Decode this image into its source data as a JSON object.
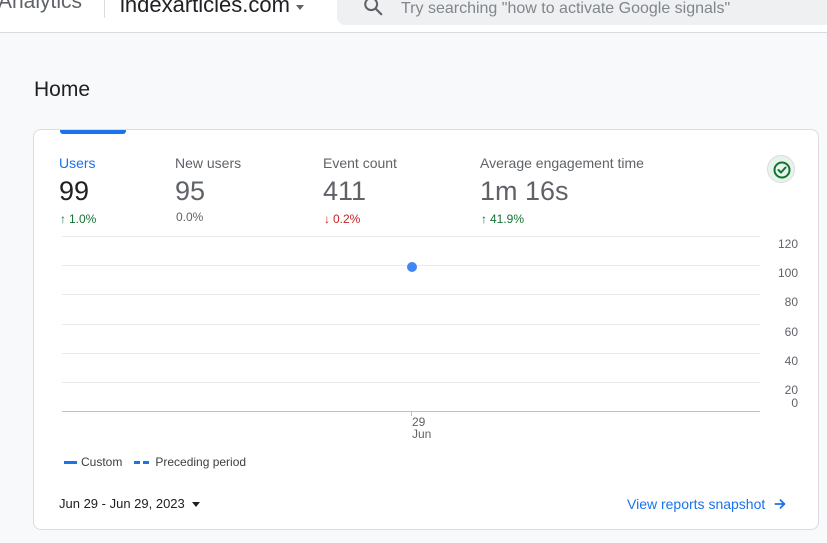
{
  "header": {
    "product_name": "Analytics",
    "property_name": "indexarticles.com",
    "search_placeholder": "Try searching \"how to activate Google signals\""
  },
  "page": {
    "title": "Home"
  },
  "metrics": [
    {
      "label": "Users",
      "value": "99",
      "change": "1.0%",
      "direction": "up",
      "active": true
    },
    {
      "label": "New users",
      "value": "95",
      "change": "0.0%",
      "direction": "none",
      "active": false
    },
    {
      "label": "Event count",
      "value": "411",
      "change": "0.2%",
      "direction": "down",
      "active": false
    },
    {
      "label": "Average engagement time",
      "value": "1m 16s",
      "change": "41.9%",
      "direction": "up",
      "active": false
    }
  ],
  "status_icon": "check-circle-icon",
  "chart_data": {
    "type": "line",
    "x": [
      "29 Jun"
    ],
    "x_tick_labels": [
      [
        "29",
        "Jun"
      ]
    ],
    "series": [
      {
        "name": "Custom",
        "values": [
          99
        ]
      }
    ],
    "y_ticks": [
      120,
      100,
      80,
      60,
      40,
      20,
      0
    ],
    "ylim": [
      0,
      120
    ],
    "grid": true,
    "legend": [
      "Custom",
      "Preceding period"
    ],
    "legend_position": "bottom-left"
  },
  "footer": {
    "date_range": "Jun 29 - Jun 29, 2023",
    "view_link": "View reports snapshot"
  },
  "colors": {
    "accent": "#1a73e8",
    "series": "#4285f4",
    "positive": "#137333",
    "negative": "#c5221f"
  }
}
